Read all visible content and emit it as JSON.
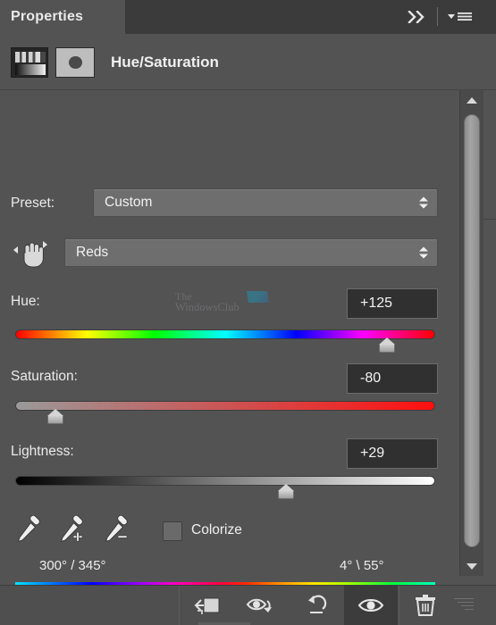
{
  "window": {
    "tab_label": "Properties",
    "collapse_icon": "double-chevron-right-icon",
    "menu_icon": "panel-menu-icon"
  },
  "title_row": {
    "adjustment_icon": "hue-saturation-adjustment-icon",
    "mask_icon": "layer-mask-thumbnail-icon",
    "title": "Hue/Saturation"
  },
  "preset": {
    "label": "Preset:",
    "value": "Custom",
    "stepper_icon": "up-down-stepper-icon"
  },
  "color_range": {
    "hand_icon": "on-image-adjustment-hand-icon",
    "value": "Reds",
    "stepper_icon": "up-down-stepper-icon"
  },
  "sliders": {
    "hue": {
      "label": "Hue:",
      "value": "+125",
      "percent": 88.5
    },
    "saturation": {
      "label": "Saturation:",
      "value": "-80",
      "percent": 9.6
    },
    "lightness": {
      "label": "Lightness:",
      "value": "+29",
      "percent": 64.5
    }
  },
  "tools": {
    "eyedropper": "eyedropper-icon",
    "eyedropper_add": "eyedropper-add-icon",
    "eyedropper_subtract": "eyedropper-subtract-icon",
    "colorize_label": "Colorize",
    "colorize_checked": false
  },
  "range_readout": {
    "left": "300° / 345°",
    "right": "4° \\ 55°"
  },
  "watermark": {
    "line1": "The",
    "line2": "WindowsClub",
    "logo_icon": "windowsclub-logo-icon"
  },
  "scrollbar": {
    "up_icon": "scroll-up-arrow-icon",
    "down_icon": "scroll-down-arrow-icon"
  },
  "toolbar": {
    "clip_to_layer_icon": "clip-to-layer-icon",
    "view_previous_icon": "view-previous-state-icon",
    "reset_icon": "reset-icon",
    "toggle_visibility_icon": "toggle-layer-visibility-icon",
    "delete_icon": "delete-layer-icon"
  },
  "colors": {
    "panel_bg": "#535353",
    "header_bg": "#3b3b3b",
    "field_bg": "#6e6e6e",
    "value_box_bg": "#303030",
    "toolbar_bg": "#4f4f4f",
    "text": "#eaeaea"
  }
}
